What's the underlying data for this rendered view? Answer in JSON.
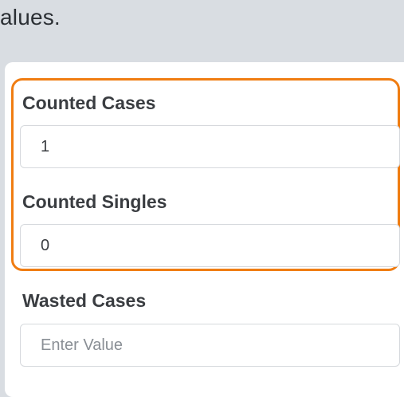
{
  "instructions": {
    "text_fragment": "alues."
  },
  "form": {
    "counted_cases": {
      "label": "Counted Cases",
      "value": "1"
    },
    "counted_singles": {
      "label": "Counted Singles",
      "value": "0"
    },
    "wasted_cases": {
      "label": "Wasted Cases",
      "value": "",
      "placeholder": "Enter Value"
    }
  },
  "colors": {
    "highlight_border": "#f07d12",
    "page_background": "#d9dde2",
    "card_background": "#ffffff"
  }
}
